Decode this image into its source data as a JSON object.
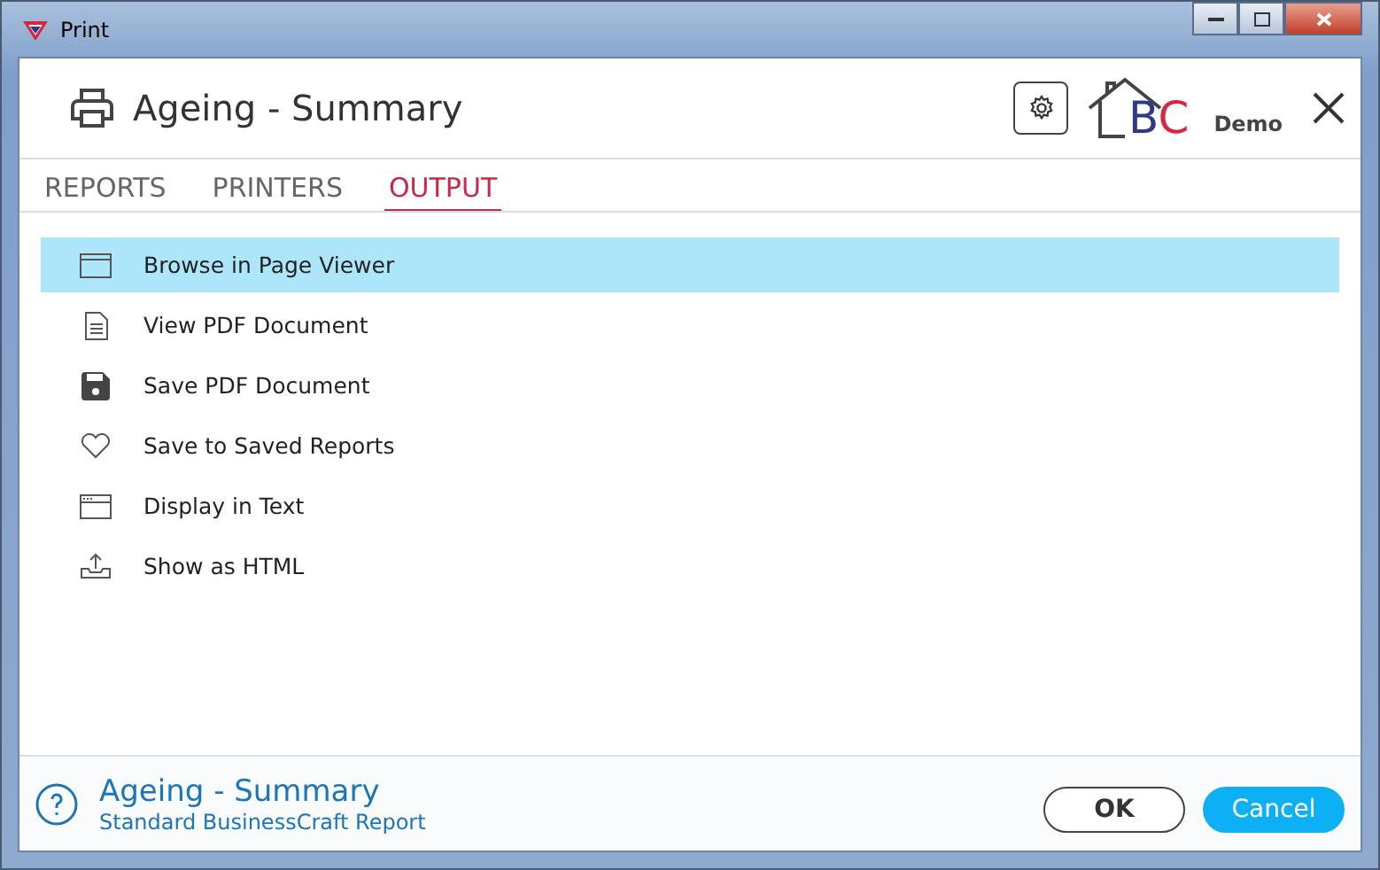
{
  "window": {
    "title": "Print"
  },
  "header": {
    "title": "Ageing - Summary",
    "logo_letters": [
      {
        "text": "B",
        "color": "#2e3a87"
      },
      {
        "text": "C",
        "color": "#d7263d"
      }
    ],
    "logo_label": "Demo"
  },
  "tabs": [
    {
      "label": "REPORTS",
      "selected": false
    },
    {
      "label": "PRINTERS",
      "selected": false
    },
    {
      "label": "OUTPUT",
      "selected": true
    }
  ],
  "outputs": [
    {
      "label": "Browse in Page Viewer",
      "kind": "window",
      "selected": true
    },
    {
      "label": "View PDF Document",
      "kind": "document",
      "selected": false
    },
    {
      "label": "Save PDF Document",
      "kind": "floppy",
      "selected": false
    },
    {
      "label": "Save to Saved Reports",
      "kind": "heart",
      "selected": false
    },
    {
      "label": "Display in Text",
      "kind": "terminal",
      "selected": false
    },
    {
      "label": "Show as HTML",
      "kind": "upload",
      "selected": false
    }
  ],
  "footer": {
    "title": "Ageing - Summary",
    "subtitle": "Standard BusinessCraft Report",
    "buttons": [
      {
        "label": "OK",
        "kind": "secondary"
      },
      {
        "label": "Cancel",
        "kind": "primary"
      }
    ]
  }
}
